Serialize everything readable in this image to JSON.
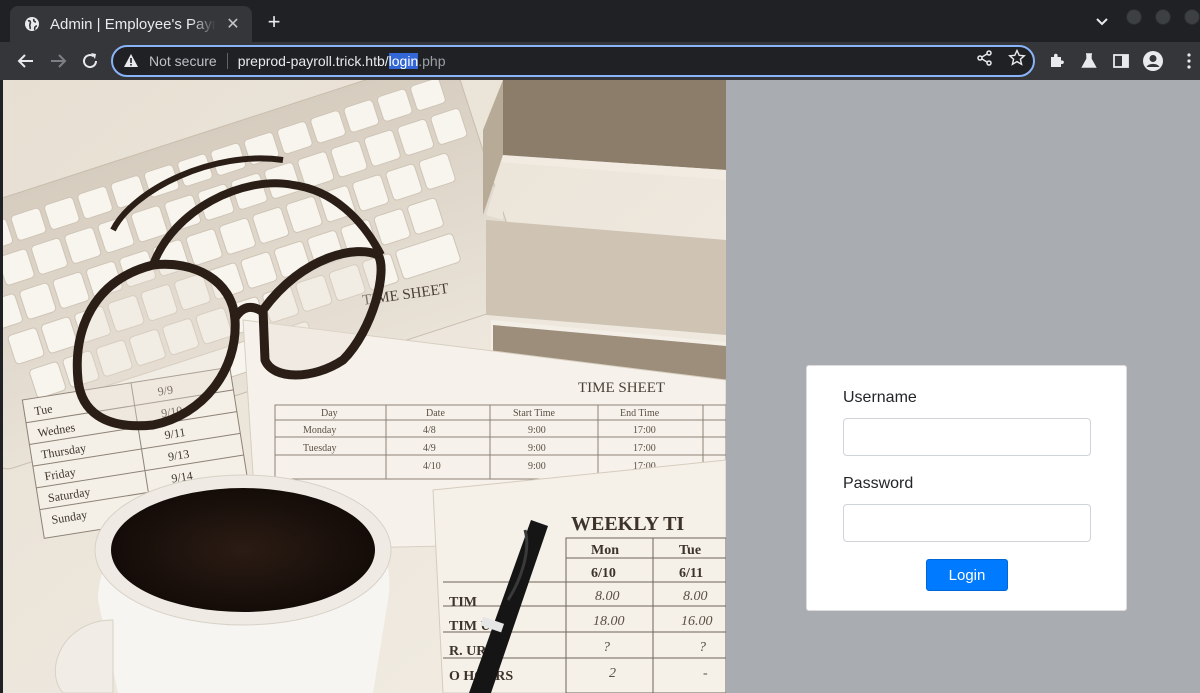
{
  "browser": {
    "tab": {
      "title": "Admin | Employee's Payroll Management System",
      "close_glyph": "✕",
      "icon": "globe-icon"
    },
    "new_tab_glyph": "+",
    "toolbar": {
      "back_icon": "back-arrow-icon",
      "forward_icon": "forward-arrow-icon",
      "reload_icon": "reload-icon"
    },
    "address_bar": {
      "security_label": "Not secure",
      "url_host": "preprod-payroll.trick.htb/",
      "url_selected": "login",
      "url_rest": ".php"
    }
  },
  "photo": {
    "timesheet_title": "TIME SHEET",
    "timesheet_cols": [
      "Day",
      "Date",
      "Start Time",
      "End Time"
    ],
    "timesheet_rows": [
      [
        "Monday",
        "4/8",
        "9:00",
        "17:00"
      ],
      [
        "Tuesday",
        "4/9",
        "9:00",
        "17:00"
      ],
      [
        "",
        "4/10",
        "9:00",
        "17:00"
      ]
    ],
    "left_days": [
      "Tue",
      "Wednes",
      "Thursday",
      "Friday",
      "Saturday",
      "Sunday"
    ],
    "left_dates": [
      "9/9",
      "9/10",
      "9/11",
      "9/13",
      "9/14"
    ],
    "weekly_title": "WEEKLY TI",
    "weekly_cols": [
      "Mon",
      "Tue"
    ],
    "weekly_dates": [
      "6/10",
      "6/11"
    ],
    "weekly_row_labels": [
      "TIM",
      "TIM  UT",
      "R.   URS",
      "O    HOURS"
    ],
    "weekly_vals": [
      [
        "8.00",
        "8.00"
      ],
      [
        "18.00",
        "16.00"
      ],
      [
        "?",
        "?"
      ],
      [
        "2",
        "-"
      ]
    ]
  },
  "login": {
    "username_label": "Username",
    "username_value": "",
    "password_label": "Password",
    "password_value": "",
    "submit_label": "Login"
  },
  "colors": {
    "accent": "#007bff",
    "page_background": "#a9acb0",
    "omnibox_focus": "#8ab4f8"
  }
}
